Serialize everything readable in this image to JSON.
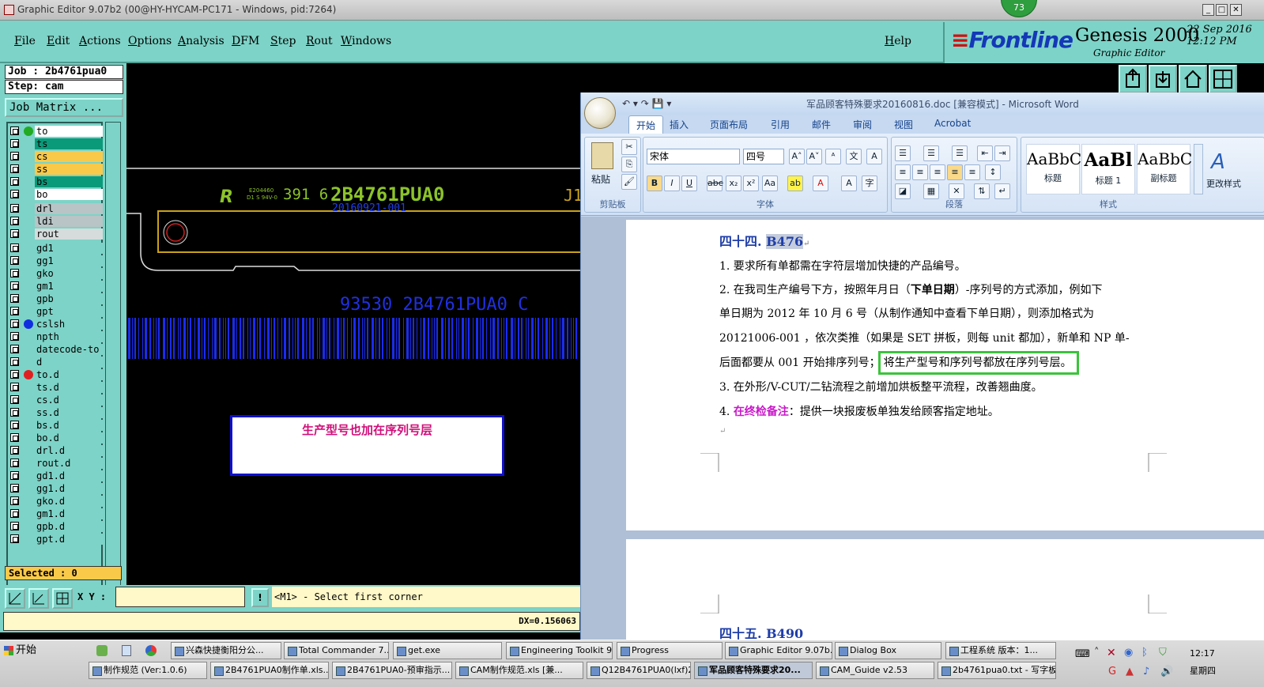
{
  "genesis": {
    "title": "Graphic Editor 9.07b2 (00@HY-HYCAM-PC171 - Windows, pid:7264)",
    "badge": "73",
    "menu": [
      "File",
      "Edit",
      "Actions",
      "Options",
      "Analysis",
      "DFM",
      "Step",
      "Rout",
      "Windows"
    ],
    "help": "Help",
    "logo_brand": "Frontline",
    "logo_product": "Genesis 2000",
    "logo_sub": "Graphic Editor",
    "date_line1": "22 Sep 2016",
    "date_line2": "12:12 PM"
  },
  "left_panel": {
    "job": "Job : 2b4761pua0",
    "step": "Step: cam",
    "job_matrix": "Job Matrix ...",
    "selected": "Selected : 0",
    "layers": [
      {
        "name": "to",
        "color": "#ffffff",
        "dot": "#22aa22"
      },
      {
        "name": "ts",
        "color": "#0a9a7a",
        "dot": ""
      },
      {
        "name": "cs",
        "color": "#f9c94a",
        "dot": ""
      },
      {
        "name": "ss",
        "color": "#f9c94a",
        "dot": ""
      },
      {
        "name": "bs",
        "color": "#0a9a7a",
        "dot": ""
      },
      {
        "name": "bo",
        "color": "#ffffff",
        "dot": ""
      },
      {
        "name": "drl",
        "color": "#b8c4c6",
        "dot": ""
      },
      {
        "name": "ldi",
        "color": "#b8c4c6",
        "dot": ""
      },
      {
        "name": "rout",
        "color": "#d6dcdc",
        "dot": ""
      },
      {
        "name": "gd1",
        "color": "#7dd3c7",
        "dot": ""
      },
      {
        "name": "gg1",
        "color": "#7dd3c7",
        "dot": ""
      },
      {
        "name": "gko",
        "color": "#7dd3c7",
        "dot": ""
      },
      {
        "name": "gm1",
        "color": "#7dd3c7",
        "dot": ""
      },
      {
        "name": "gpb",
        "color": "#7dd3c7",
        "dot": ""
      },
      {
        "name": "gpt",
        "color": "#7dd3c7",
        "dot": ""
      },
      {
        "name": "cslsh",
        "color": "#7dd3c7",
        "dot": "#1030e0"
      },
      {
        "name": "npth",
        "color": "#7dd3c7",
        "dot": ""
      },
      {
        "name": "datecode-to",
        "color": "#7dd3c7",
        "dot": ""
      },
      {
        "name": "d",
        "color": "#7dd3c7",
        "dot": ""
      },
      {
        "name": "to.d",
        "color": "#7dd3c7",
        "dot": "#e02020"
      },
      {
        "name": "ts.d",
        "color": "#7dd3c7",
        "dot": ""
      },
      {
        "name": "cs.d",
        "color": "#7dd3c7",
        "dot": ""
      },
      {
        "name": "ss.d",
        "color": "#7dd3c7",
        "dot": ""
      },
      {
        "name": "bs.d",
        "color": "#7dd3c7",
        "dot": ""
      },
      {
        "name": "bo.d",
        "color": "#7dd3c7",
        "dot": ""
      },
      {
        "name": "drl.d",
        "color": "#7dd3c7",
        "dot": ""
      },
      {
        "name": "rout.d",
        "color": "#7dd3c7",
        "dot": ""
      },
      {
        "name": "gd1.d",
        "color": "#7dd3c7",
        "dot": ""
      },
      {
        "name": "gg1.d",
        "color": "#7dd3c7",
        "dot": ""
      },
      {
        "name": "gko.d",
        "color": "#7dd3c7",
        "dot": ""
      },
      {
        "name": "gm1.d",
        "color": "#7dd3c7",
        "dot": ""
      },
      {
        "name": "gpb.d",
        "color": "#7dd3c7",
        "dot": ""
      },
      {
        "name": "gpt.d",
        "color": "#7dd3c7",
        "dot": ""
      }
    ]
  },
  "canvas": {
    "silk_code": "391 6",
    "silk_part": "2B4761PUA0",
    "silk_small": "E204460\nD1 S 94V-0",
    "silk_date": "20160921-001",
    "silk_j": "J1",
    "barcode_text": "93530  2B4761PUA0  C",
    "annotation": "生产型号也加在序列号层"
  },
  "bottom": {
    "xy_label": "X Y :",
    "xy_value": "",
    "bang": "!",
    "prompt": "<M1> - Select first corner",
    "dx": "DX=0.156063"
  },
  "word": {
    "title": "军品顾客特殊要求20160816.doc [兼容模式] - Microsoft Word",
    "tabs": [
      "开始",
      "插入",
      "页面布局",
      "引用",
      "邮件",
      "审阅",
      "视图",
      "Acrobat"
    ],
    "paste": "粘贴",
    "groups": [
      "剪贴板",
      "字体",
      "段落",
      "样式"
    ],
    "font": "宋体",
    "size": "四号",
    "styles": [
      {
        "sample": "AaBbC",
        "name": "标题"
      },
      {
        "sample": "AaBl",
        "name": "标题 1"
      },
      {
        "sample": "AaBbC",
        "name": "副标题"
      }
    ],
    "change_styles": "更改样式",
    "heading44_prefix": "四十四. ",
    "heading44_code": "B476",
    "line1": "1. 要求所有单都需在字符层增加快捷的产品编号。",
    "line2a": "2. 在我司生产编号下方，按照年月日（",
    "line2b": "下单日期",
    "line2c": "）-序列号的方式添加，例如下",
    "line3": "单日期为 2012 年 10 月 6 号（从制作通知中查看下单日期），则添加格式为",
    "line4": "20121006-001 ，依次类推（如果是 SET 拼板，则每 unit 都加），新单和 NP 单-",
    "line5a": "后面都要从 001 开始排序列号；",
    "line5b": "将生产型号和序列号都放在序列号层。",
    "line6": "3. 在外形/V-CUT/二钻流程之前增加烘板整平流程，改善翘曲度。",
    "line7a": "4. ",
    "line7b": "在终检备注",
    "line7c": "：提供一块报废板单独发给顾客指定地址。",
    "heading45_prefix": "四十五. ",
    "heading45_code": "B490"
  },
  "taskbar": {
    "start": "开始",
    "row1": [
      "兴森快捷衡阳分公...",
      "Total Commander 7....",
      "get.exe",
      "Engineering Toolkit 9...",
      "Progress",
      "Graphic Editor 9.07b...",
      "Dialog Box",
      "工程系统  版本：1..."
    ],
    "row2": [
      "制作规范 (Ver:1.0.6)",
      "2B4761PUA0制作单.xls...",
      "2B4761PUA0-预审指示...",
      "CAM制作规范.xls [兼...",
      "Q12B4761PUA0(lxf)201...",
      "军品顾客特殊要求20...",
      "CAM_Guide v2.53",
      "2b4761pua0.txt - 写字板"
    ],
    "time": "12:17",
    "weekday": "星期四"
  }
}
